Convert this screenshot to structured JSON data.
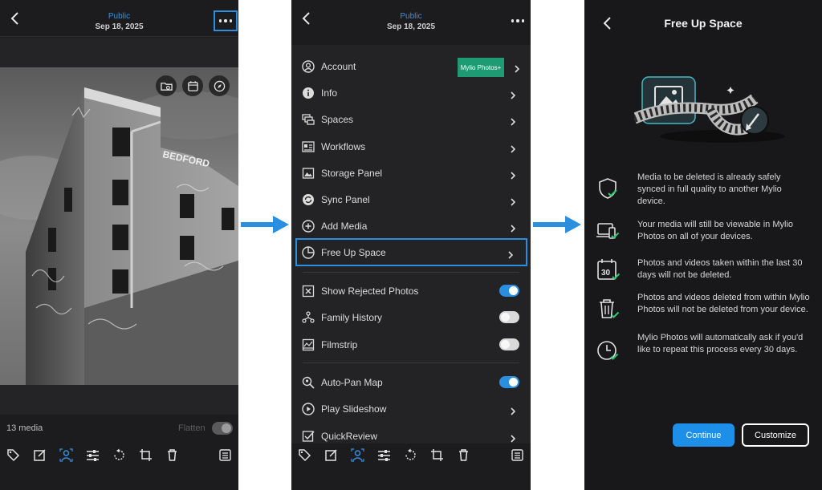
{
  "screen1": {
    "title": "Public",
    "date": "Sep 18, 2025",
    "media_count": "13 media",
    "flatten_label": "Flatten",
    "photo_sign_lettering": "BEDFORD",
    "overlay_icons": [
      "folder-icon",
      "calendar-icon",
      "compass-icon"
    ],
    "toolbar_icons": [
      "tag-icon",
      "edit-icon",
      "faces-icon",
      "adjust-icon",
      "rotate-icon",
      "crop-icon",
      "trash-icon",
      "info-panel-icon"
    ]
  },
  "screen2": {
    "title": "Public",
    "date": "Sep 18, 2025",
    "badge": "Mylio Photos+",
    "menu": [
      {
        "label": "Account",
        "icon": "account-icon"
      },
      {
        "label": "Info",
        "icon": "info-icon"
      },
      {
        "label": "Spaces",
        "icon": "spaces-icon"
      },
      {
        "label": "Workflows",
        "icon": "workflows-icon"
      },
      {
        "label": "Storage Panel",
        "icon": "storage-icon"
      },
      {
        "label": "Sync Panel",
        "icon": "sync-icon"
      },
      {
        "label": "Add Media",
        "icon": "add-icon"
      },
      {
        "label": "Free Up Space",
        "icon": "pie-icon",
        "selected": true
      }
    ],
    "toggles": [
      {
        "label": "Show Rejected Photos",
        "icon": "reject-icon",
        "on": true
      },
      {
        "label": "Family History",
        "icon": "tree-icon",
        "on": false
      },
      {
        "label": "Filmstrip",
        "icon": "filmstrip-icon",
        "on": false
      }
    ],
    "more": [
      {
        "label": "Auto-Pan Map",
        "icon": "map-search-icon",
        "on": true
      },
      {
        "label": "Play Slideshow",
        "icon": "play-icon"
      },
      {
        "label": "QuickReview",
        "icon": "quickreview-icon"
      }
    ]
  },
  "screen3": {
    "title": "Free Up Space",
    "items": [
      {
        "icon": "shield-check-icon",
        "text": "Media to be deleted is already safely synced in full quality to another Mylio device."
      },
      {
        "icon": "devices-check-icon",
        "text": "Your media will still be viewable in Mylio Photos on all of your devices."
      },
      {
        "icon": "calendar-30-icon",
        "text": "Photos and videos taken within the last 30 days will not be deleted."
      },
      {
        "icon": "trash-check-icon",
        "text": "Photos and videos deleted from within Mylio Photos will not be deleted from your device."
      },
      {
        "icon": "clock-check-icon",
        "text": "Mylio Photos will automatically ask if you'd like to repeat this process every 30 days."
      }
    ],
    "calendar_icon_number": "30",
    "continue_label": "Continue",
    "customize_label": "Customize"
  },
  "colors": {
    "accent": "#2b8fe0",
    "badge": "#1e9b73",
    "panel_bg": "#1c1c1e",
    "check": "#2ecc71"
  }
}
